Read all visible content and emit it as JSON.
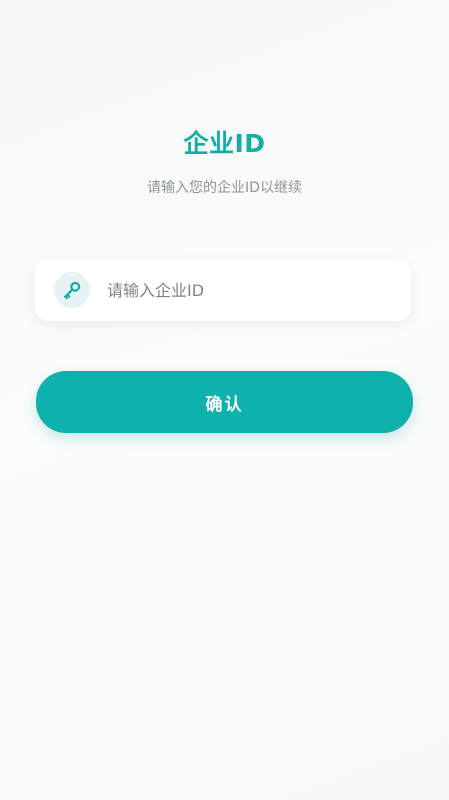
{
  "header": {
    "title": "企业ID",
    "subtitle": "请输入您的企业ID以继续"
  },
  "form": {
    "input": {
      "icon": "key-icon",
      "value": "",
      "placeholder": "请输入企业ID"
    },
    "confirm_label": "确认"
  },
  "colors": {
    "accent": "#0fb1ac",
    "title": "#14ada6",
    "subtitle": "#8d949a",
    "icon_bg": "#e7f3f2",
    "background": "#f7fafa"
  }
}
